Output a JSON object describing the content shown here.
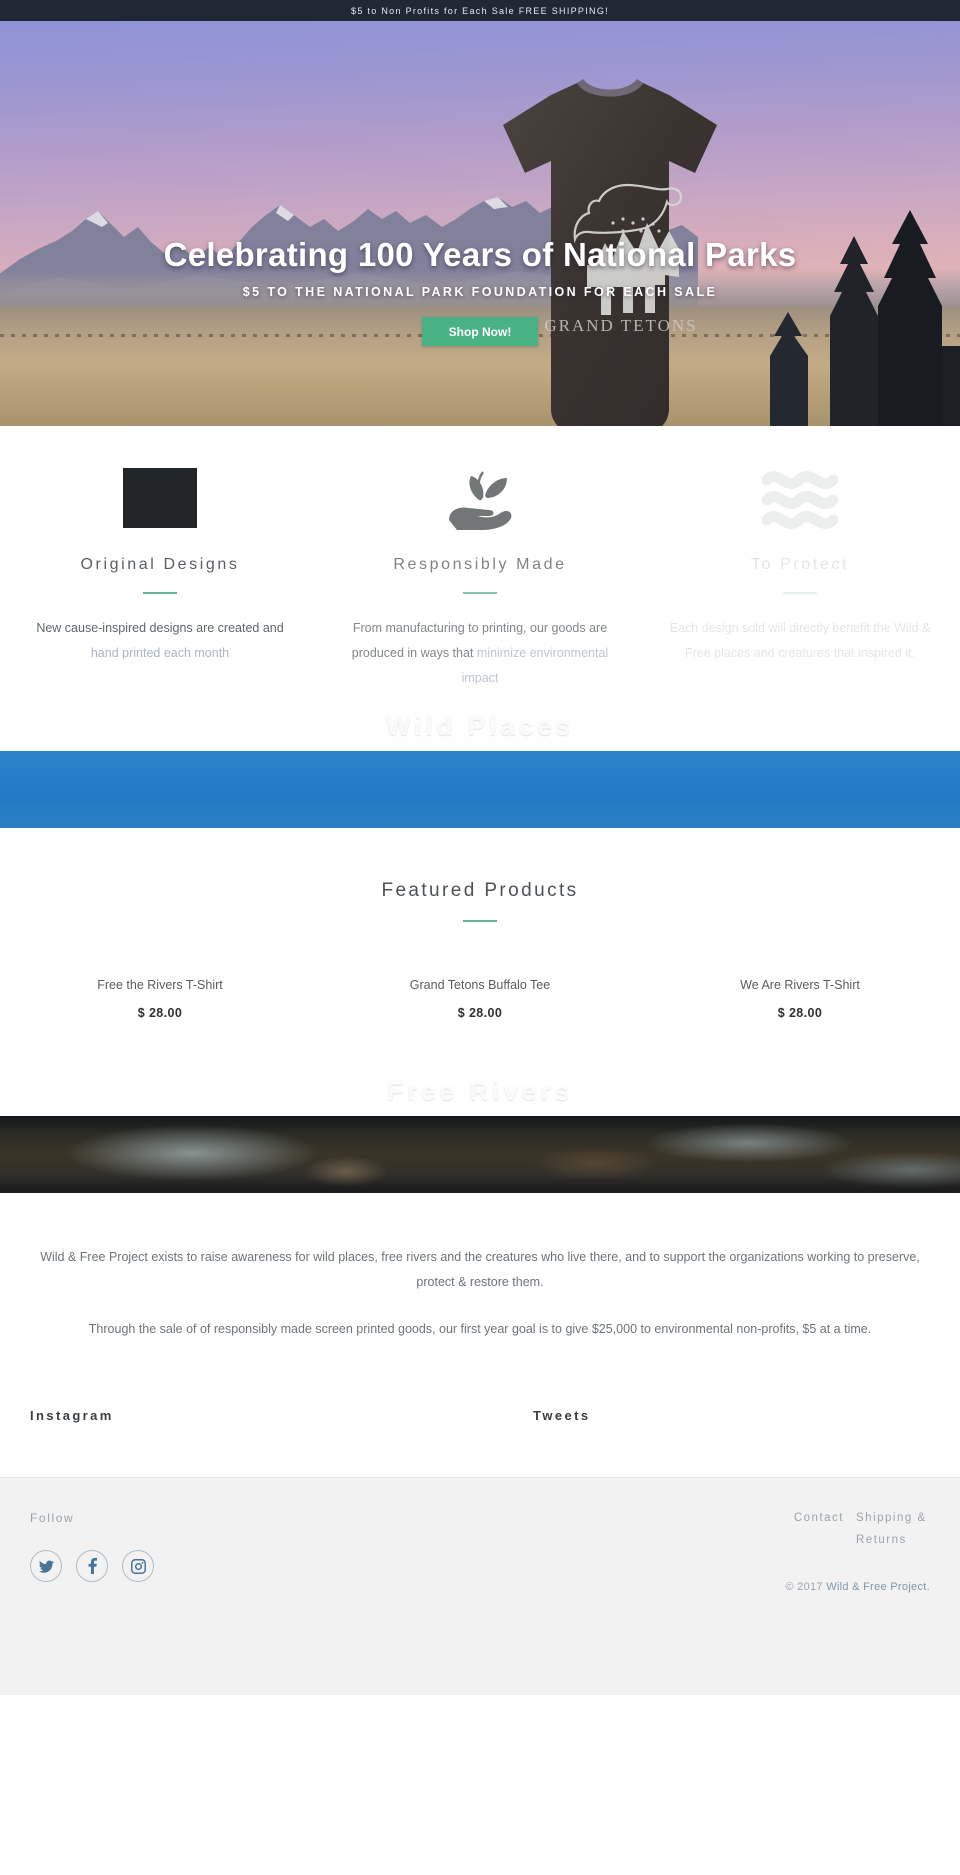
{
  "announcement": {
    "text": "$5 to Non Profits for Each Sale FREE SHIPPING!"
  },
  "hero": {
    "title": "Celebrating 100 Years of National Parks",
    "subtitle": "$5 TO THE NATIONAL PARK FOUNDATION FOR EACH SALE",
    "cta_label": "Shop Now!",
    "shirt_graphic_text": "GRAND TETONS",
    "cta_color": "#49b285"
  },
  "features": [
    {
      "icon": "image-icon",
      "title": "Original Designs",
      "text_main": "New cause-inspired designs are created and ",
      "text_tail": "hand printed each month"
    },
    {
      "icon": "hand-plant-icon",
      "title": "Responsibly Made",
      "text_main": "From manufacturing to printing, our goods are produced in ways that ",
      "text_tail": "minimize environmental impact"
    },
    {
      "icon": "waves-icon",
      "title": "To Protect",
      "text_main": "Each design sold will directly benefit the Wild & Free places and creatures that inspired it.",
      "text_tail": ""
    }
  ],
  "bands": [
    {
      "label": "Wild Places",
      "kind": "blue"
    },
    {
      "label": "Free Rivers",
      "kind": "river"
    }
  ],
  "featured": {
    "heading": "Featured Products",
    "products": [
      {
        "name": "Free the Rivers T-Shirt",
        "price": "$ 28.00"
      },
      {
        "name": "Grand Tetons Buffalo Tee",
        "price": "$ 28.00"
      },
      {
        "name": "We Are Rivers T-Shirt",
        "price": "$ 28.00"
      }
    ]
  },
  "about": {
    "paragraph1": "Wild & Free Project exists to raise awareness for wild places, free rivers and the creatures who live there, and to support the organizations working to preserve, protect & restore them.",
    "paragraph2": "Through the sale of of responsibly made screen printed goods, our first year goal is to give $25,000 to environmental non-profits, $5 at a time."
  },
  "feeds": {
    "instagram_heading": "Instagram",
    "tweets_heading": "Tweets"
  },
  "footer": {
    "follow_label": "Follow",
    "social": [
      {
        "name": "twitter-icon"
      },
      {
        "name": "facebook-icon"
      },
      {
        "name": "instagram-icon"
      }
    ],
    "links": [
      {
        "label": "Contact"
      },
      {
        "label": "Shipping & Returns"
      }
    ],
    "copyright_mark": "©",
    "copyright_year_text": " 2017 ",
    "copyright_brand": "Wild & Free Project."
  }
}
